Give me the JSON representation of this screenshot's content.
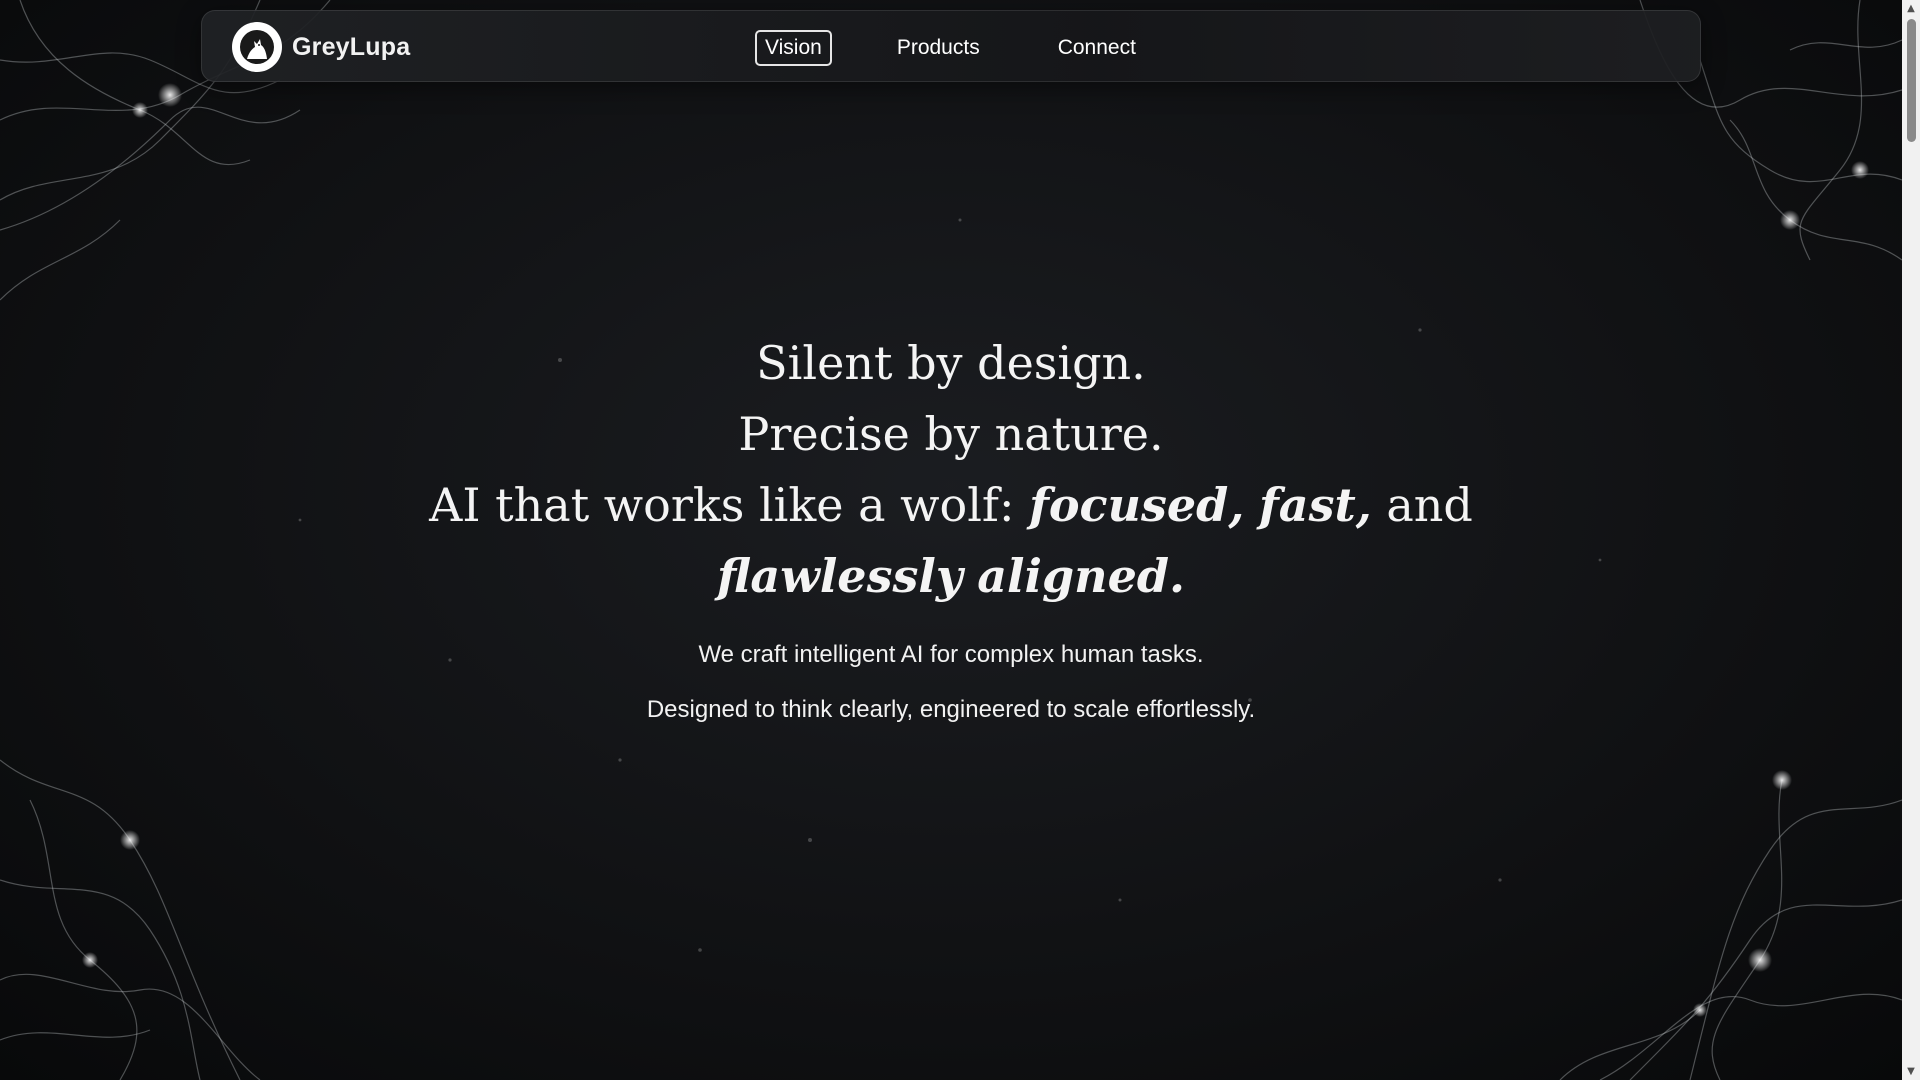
{
  "brand": {
    "name": "GreyLupa",
    "logo_icon": "wolf-howling-icon"
  },
  "nav": {
    "items": [
      {
        "label": "Vision",
        "active": true
      },
      {
        "label": "Products",
        "active": false
      },
      {
        "label": "Connect",
        "active": false
      }
    ]
  },
  "hero": {
    "line1": "Silent by design.",
    "line2": "Precise by nature.",
    "line3_prefix": "AI that works like a wolf:",
    "word_focused": "focused,",
    "word_fast": "fast,",
    "word_and": "and",
    "word_flawlessly": "flawlessly",
    "word_aligned": "aligned.",
    "sub1": "We craft intelligent AI for complex human tasks.",
    "sub2": "Designed to think clearly, engineered to scale effortlessly."
  },
  "colors": {
    "background": "#0f1012",
    "text": "#ffffff",
    "nav_bg": "#1e2023",
    "scrollbar_track": "#f1f1f1",
    "scrollbar_thumb": "#8a8a8a"
  },
  "scrollbar": {
    "up_icon": "triangle-up-icon",
    "down_icon": "triangle-down-icon"
  }
}
